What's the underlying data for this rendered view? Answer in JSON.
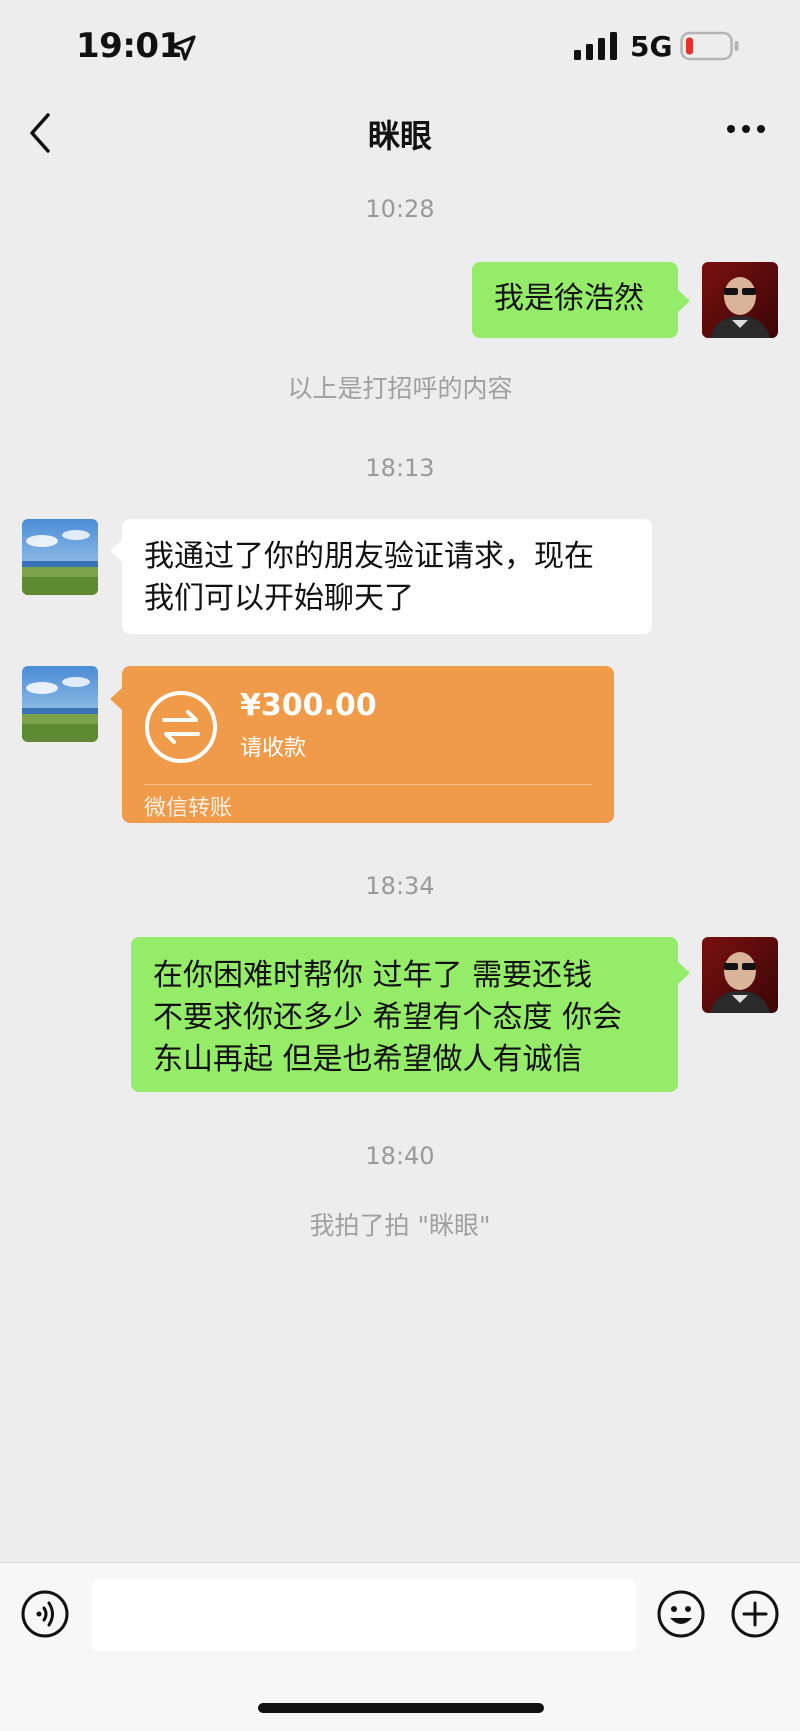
{
  "status_bar": {
    "time": "19:01",
    "network": "5G",
    "icons": [
      "location-arrow-icon",
      "signal-bars-icon",
      "battery-low-icon"
    ]
  },
  "nav": {
    "title": "眯眼",
    "icons": [
      "back-chevron-icon",
      "more-dots-icon"
    ]
  },
  "chat": {
    "messages": [
      {
        "type": "time",
        "text": "10:28"
      },
      {
        "type": "text",
        "side": "right",
        "text": "我是徐浩然"
      },
      {
        "type": "system",
        "text": "以上是打招呼的内容"
      },
      {
        "type": "time",
        "text": "18:13"
      },
      {
        "type": "text",
        "side": "left",
        "lines": [
          "我通过了你的朋友验证请求，现在",
          "我们可以开始聊天了"
        ]
      },
      {
        "type": "transfer",
        "side": "left",
        "amount": "¥300.00",
        "status": "请收款",
        "footer": "微信转账"
      },
      {
        "type": "time",
        "text": "18:34"
      },
      {
        "type": "text",
        "side": "right",
        "lines": [
          "在你困难时帮你 过年了 需要还钱",
          "不要求你还多少 希望有个态度 你会",
          "东山再起 但是也希望做人有诚信"
        ]
      },
      {
        "type": "time",
        "text": "18:40"
      },
      {
        "type": "system",
        "text": "我拍了拍 \"眯眼\""
      }
    ]
  },
  "colors": {
    "background": "#ededed",
    "bubble_self": "#95ec69",
    "bubble_other": "#ffffff",
    "transfer": "#f09b49",
    "battery_low": "#e5322d"
  },
  "input_bar": {
    "icons": [
      "voice-icon",
      "emoji-icon",
      "plus-icon"
    ]
  }
}
